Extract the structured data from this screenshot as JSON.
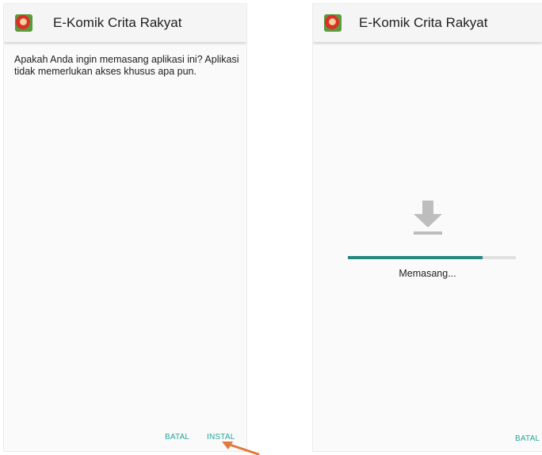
{
  "left_screen": {
    "app_title": "E-Komik Crita Rakyat",
    "prompt": "Apakah Anda ingin memasang aplikasi ini? Aplikasi tidak memerlukan akses khusus apa pun.",
    "cancel_label": "BATAL",
    "install_label": "INSTAL"
  },
  "right_screen": {
    "app_title": "E-Komik Crita Rakyat",
    "status": "Memasang...",
    "progress_percent": 80,
    "cancel_label": "BATAL"
  },
  "icons": {
    "app": "app-icon",
    "download": "download-icon",
    "pointer": "arrow-icon"
  },
  "colors": {
    "accent": "#26a69a",
    "progress": "#26877f",
    "annotation_arrow": "#e07a3c"
  }
}
